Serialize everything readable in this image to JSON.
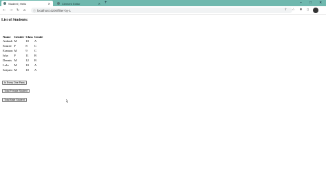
{
  "browser": {
    "tabs": [
      {
        "title": "Student | Hello",
        "active": true
      },
      {
        "title": "Clement Editor",
        "active": false
      }
    ],
    "new_tab": "+",
    "url": "localhost:4200/filter-by-1"
  },
  "page": {
    "heading": "List of Students:",
    "table": {
      "headers": [
        "Name",
        "Gender",
        "Class",
        "Grade"
      ],
      "rows": [
        [
          "Ankush",
          "M",
          "10",
          "A"
        ],
        [
          "Sourav",
          "F",
          "8",
          "C"
        ],
        [
          "Eramon",
          "M",
          "9",
          "C"
        ],
        [
          "Isha",
          "F",
          "11",
          "B"
        ],
        [
          "Dennis",
          "M",
          "12",
          "B"
        ],
        [
          "Lolo",
          "M",
          "10",
          "A"
        ],
        [
          "Satyam",
          "M",
          "10",
          "A"
        ]
      ]
    },
    "buttons": {
      "every_one_pass": "Is Every One Pass",
      "total_female": "Total Female Student",
      "total_male": "Total Male Student"
    }
  }
}
